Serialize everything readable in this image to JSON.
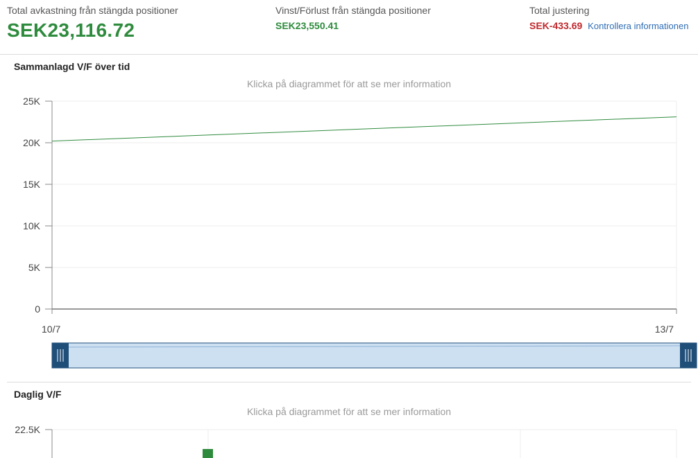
{
  "summary": {
    "total_return": {
      "label": "Total avkastning från stängda positioner",
      "value": "SEK23,116.72"
    },
    "pnl": {
      "label": "Vinst/Förlust från stängda positioner",
      "value": "SEK23,550.41"
    },
    "adjustment": {
      "label": "Total justering",
      "value": "SEK-433.69",
      "link_label": "Kontrollera informationen"
    }
  },
  "colors": {
    "positive": "#2e8b3d",
    "negative": "#c0282d",
    "link": "#2f6db5",
    "navigator_fill": "#cde0f2",
    "navigator_handle": "#1f4e79"
  },
  "cumulative_section": {
    "title": "Sammanlagd V/F över tid",
    "hint": "Klicka på diagrammet för att se mer information"
  },
  "daily_section": {
    "title": "Daglig V/F",
    "hint": "Klicka på diagrammet för att se mer information"
  },
  "chart_data": [
    {
      "type": "line",
      "title": "Sammanlagd V/F över tid",
      "x_tick_labels": [
        "10/7",
        "13/7"
      ],
      "y_tick_labels": [
        "0",
        "5K",
        "10K",
        "15K",
        "20K",
        "25K"
      ],
      "y_ticks": [
        0,
        5000,
        10000,
        15000,
        20000,
        25000
      ],
      "ylim": [
        0,
        25000
      ],
      "grid": true,
      "series": [
        {
          "points": [
            {
              "x": "10/7",
              "y": 20200
            },
            {
              "x": "13/7",
              "y": 23116.72
            }
          ]
        }
      ],
      "navigator": {
        "range_start": 0,
        "range_end": 1
      }
    },
    {
      "type": "bar",
      "title": "Daglig V/F",
      "y_tick_labels": [
        "22.5K"
      ],
      "grid": true,
      "partial_view": true
    }
  ]
}
